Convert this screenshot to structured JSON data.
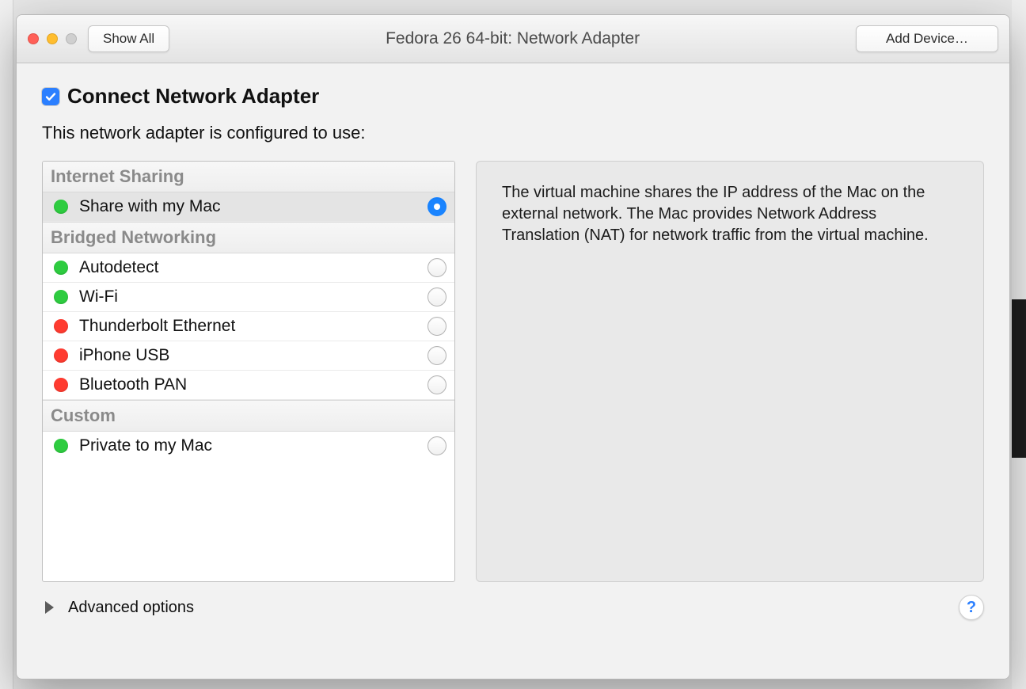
{
  "titlebar": {
    "show_all": "Show All",
    "title": "Fedora 26 64-bit: Network Adapter",
    "add_device": "Add Device…"
  },
  "connect": {
    "checked": true,
    "label": "Connect Network Adapter"
  },
  "subtitle": "This network adapter is configured to use:",
  "sections": [
    {
      "header": "Internet Sharing",
      "rows": [
        {
          "label": "Share with my Mac",
          "status": "green",
          "selected": true
        }
      ]
    },
    {
      "header": "Bridged Networking",
      "rows": [
        {
          "label": "Autodetect",
          "status": "green",
          "selected": false
        },
        {
          "label": "Wi-Fi",
          "status": "green",
          "selected": false
        },
        {
          "label": "Thunderbolt Ethernet",
          "status": "red",
          "selected": false
        },
        {
          "label": "iPhone USB",
          "status": "red",
          "selected": false
        },
        {
          "label": "Bluetooth PAN",
          "status": "red",
          "selected": false
        }
      ]
    },
    {
      "header": "Custom",
      "rows": [
        {
          "label": "Private to my Mac",
          "status": "green",
          "selected": false
        }
      ]
    }
  ],
  "description": "The virtual machine shares the IP address of the Mac on the external network. The Mac provides Network Address Translation (NAT) for network traffic from the virtual machine.",
  "footer": {
    "advanced": "Advanced options",
    "help": "?"
  }
}
